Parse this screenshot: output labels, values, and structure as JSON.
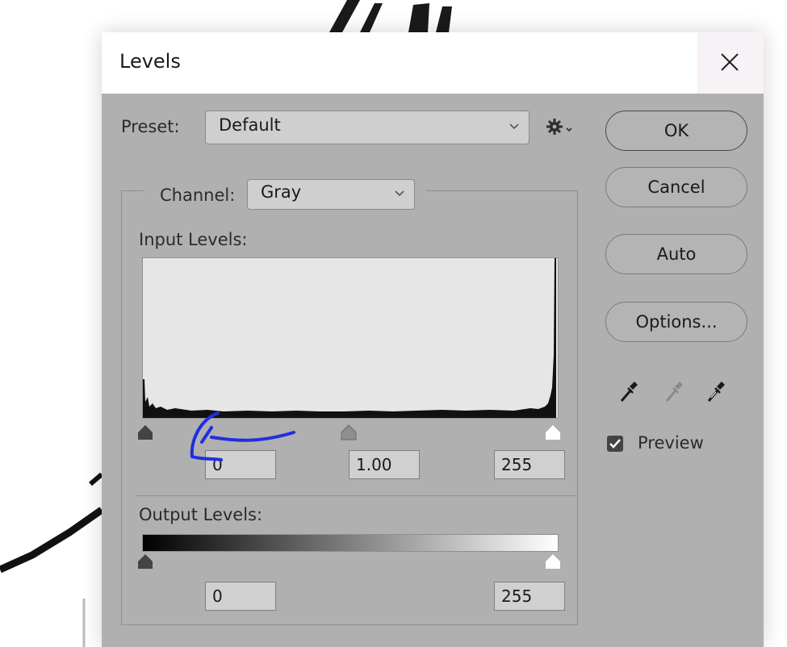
{
  "dialog": {
    "title": "Levels",
    "close_icon": "close-icon"
  },
  "preset": {
    "label": "Preset:",
    "value": "Default",
    "menu_icon": "gear-icon"
  },
  "channel": {
    "label": "Channel:",
    "value": "Gray"
  },
  "input_levels": {
    "label": "Input Levels:",
    "black": "0",
    "gamma": "1.00",
    "white": "255"
  },
  "output_levels": {
    "label": "Output Levels:",
    "black": "0",
    "white": "255"
  },
  "buttons": {
    "ok": "OK",
    "cancel": "Cancel",
    "auto": "Auto",
    "options": "Options..."
  },
  "eyedroppers": [
    "black-eyedropper-icon",
    "gray-eyedropper-icon",
    "white-eyedropper-icon"
  ],
  "preview": {
    "label": "Preview",
    "checked": true
  },
  "colors": {
    "dialog_bg": "#b0b0b0",
    "annotation": "#1f2fe0"
  }
}
